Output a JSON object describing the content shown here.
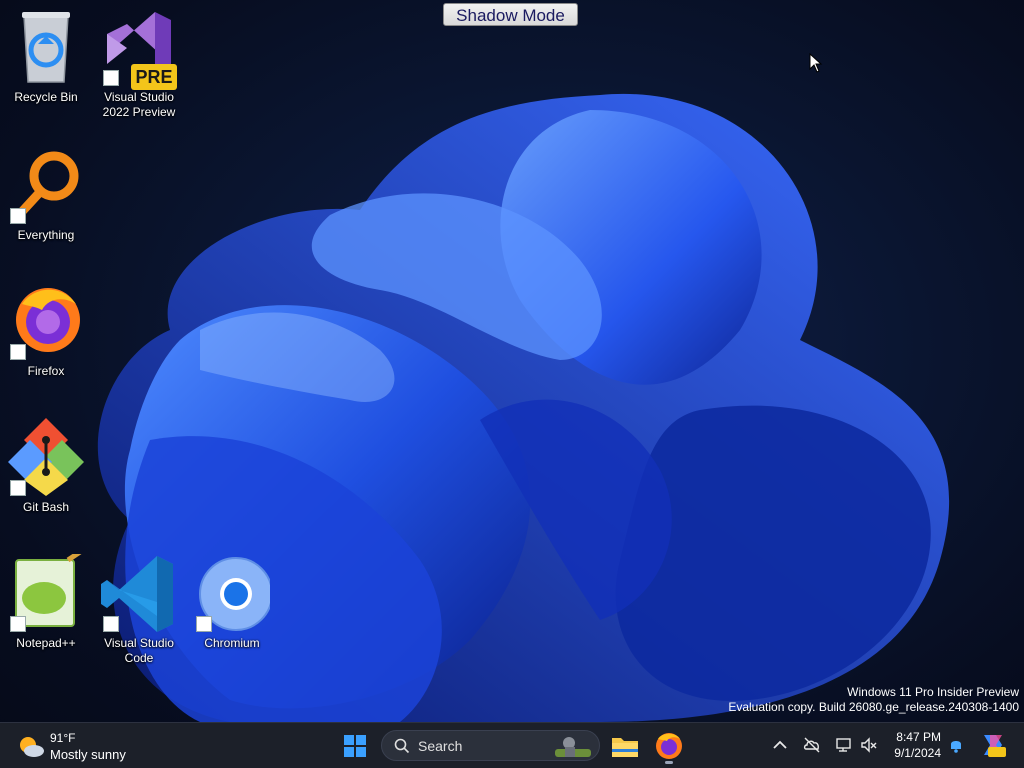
{
  "banner": {
    "label": "Shadow Mode"
  },
  "desktop_icons": [
    {
      "label": "Recycle Bin",
      "icon": "recycle-bin-icon"
    },
    {
      "label": "Visual Studio 2022 Preview",
      "badge": "PRE",
      "icon": "visual-studio-preview-icon"
    },
    {
      "label": "Everything",
      "icon": "everything-search-icon"
    },
    {
      "label": "Firefox",
      "icon": "firefox-icon"
    },
    {
      "label": "Git Bash",
      "icon": "git-bash-icon"
    },
    {
      "label": "Notepad++",
      "icon": "notepad-plus-plus-icon"
    },
    {
      "label": "Visual Studio Code",
      "icon": "vscode-icon"
    },
    {
      "label": "Chromium",
      "icon": "chromium-icon"
    }
  ],
  "watermark": {
    "line1": "Windows 11 Pro Insider Preview",
    "line2": "Evaluation copy. Build 26080.ge_release.240308-1400"
  },
  "taskbar": {
    "weather": {
      "temp": "91°F",
      "condition": "Mostly sunny"
    },
    "search": {
      "placeholder": "Search"
    },
    "clock": {
      "time": "8:47 PM",
      "date": "9/1/2024"
    }
  },
  "colors": {
    "accent": "#1f5fff",
    "taskbar": "#1c2029",
    "desktop_bg": "#070d20"
  }
}
